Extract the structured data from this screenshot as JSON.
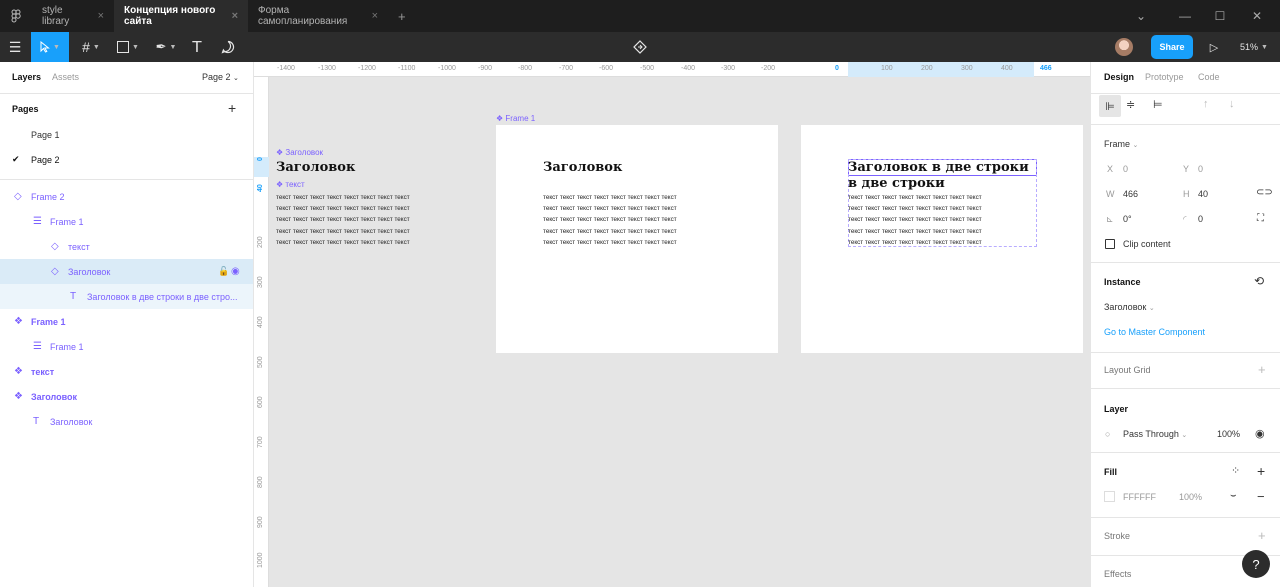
{
  "titlebar": {
    "logo": "figma-logo",
    "tabs": [
      {
        "label": "style library"
      },
      {
        "label": "Концепция нового сайта"
      },
      {
        "label": "Форма самопланирования"
      }
    ],
    "new_tab": "+"
  },
  "toolbar": {
    "zoom": "51%",
    "share_label": "Share"
  },
  "left_panel": {
    "tab_layers": "Layers",
    "tab_assets": "Assets",
    "page_select": "Page 2",
    "pages_title": "Pages",
    "add_page": "+",
    "pages": [
      "Page 1",
      "Page 2"
    ],
    "layers": [
      {
        "label": "Frame 2"
      },
      {
        "label": "Frame 1"
      },
      {
        "label": "текст"
      },
      {
        "label": "Заголовок"
      },
      {
        "label": "Заголовок в две строки в две стро..."
      },
      {
        "label": "Frame 1"
      },
      {
        "label": "Frame 1"
      },
      {
        "label": "текст"
      },
      {
        "label": "Заголовок"
      },
      {
        "label": "Заголовок"
      }
    ]
  },
  "rulers": {
    "top": [
      "-1400",
      "-1300",
      "-1200",
      "-1100",
      "-1000",
      "-900",
      "-800",
      "-700",
      "-600",
      "-500",
      "-400",
      "-300",
      "-200",
      "0",
      "100",
      "200",
      "300",
      "400",
      "466"
    ],
    "left": [
      "0",
      "40",
      "200",
      "300",
      "400",
      "500",
      "600",
      "700",
      "800",
      "900",
      "1000"
    ]
  },
  "canvas": {
    "comp_heading_label": "Заголовок",
    "comp_text_label": "текст",
    "frame_label": "Frame 1",
    "heading_1": "Заголовок",
    "heading_2": "Заголовок",
    "heading_3": "Заголовок в две строки в две строки",
    "body_line": "текст текст текст текст текст текст текст текст"
  },
  "right_panel": {
    "tabs": [
      "Design",
      "Prototype",
      "Code"
    ],
    "frame_label": "Frame",
    "x_label": "X",
    "x": "0",
    "y_label": "Y",
    "y": "0",
    "w_label": "W",
    "w": "466",
    "h_label": "H",
    "h": "40",
    "rotation": "0°",
    "radius": "0",
    "clip_content": "Clip content",
    "instance_title": "Instance",
    "instance_value": "Заголовок",
    "go_master": "Go to Master Component",
    "layout_grid": "Layout Grid",
    "layer_title": "Layer",
    "blend": "Pass Through",
    "layer_opacity": "100%",
    "fill_title": "Fill",
    "fill_hex": "FFFFFF",
    "fill_opacity": "100%",
    "stroke_title": "Stroke",
    "effects_title": "Effects",
    "help": "?"
  },
  "colors": {
    "accent": "#18a0fb",
    "component": "#7b61ff",
    "dark": "#2c2c2c"
  }
}
